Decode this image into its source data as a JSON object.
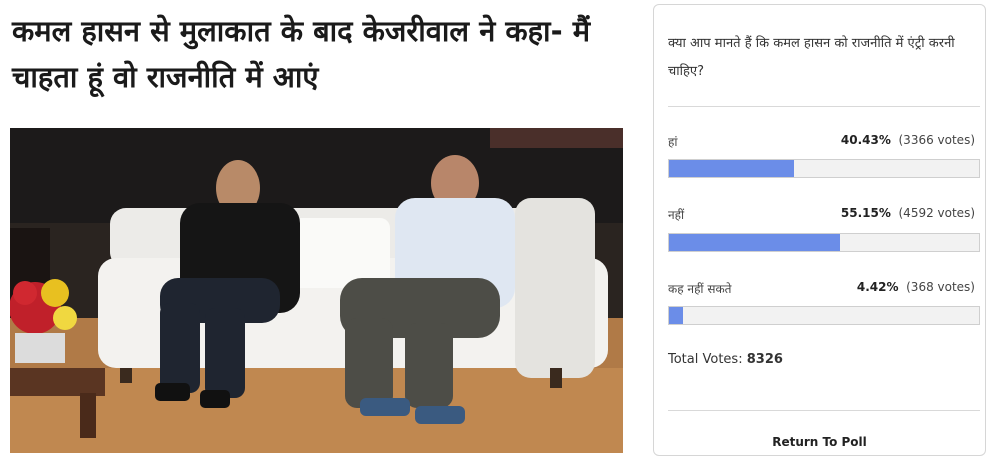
{
  "article": {
    "headline": "कमल हासन से मुलाकात के बाद केजरीवाल ने कहा- मैं चाहता हूं वो राजनीति में आएं"
  },
  "poll": {
    "question": "क्या आप मानते हैं कि कमल हासन को राजनीति में एंट्री करनी चाहिए?",
    "options": [
      {
        "label": "हां",
        "percent": "40.43%",
        "votes": "(3366 votes)",
        "fraction": 0.4043
      },
      {
        "label": "नहीं",
        "percent": "55.15%",
        "votes": "(4592 votes)",
        "fraction": 0.5515
      },
      {
        "label": "कह नहीं सकते",
        "percent": "4.42%",
        "votes": "(368 votes)",
        "fraction": 0.0442
      }
    ],
    "total_label": "Total Votes:",
    "total_value": "8326",
    "return_label": "Return To Poll",
    "bar_color": "#6b8de8"
  }
}
